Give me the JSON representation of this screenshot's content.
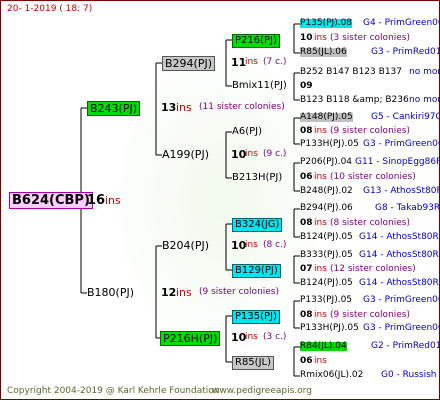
{
  "header": {
    "date": "20-  1-2019 ( 18:  7)"
  },
  "footer": {
    "copyright": "Copyright 2004-2019 @ Karl Kehrle Foundation",
    "site": "www.pedigreeapis.org"
  },
  "root": {
    "name": "B624(CBP)",
    "ins": "16",
    "ins_label": "ins"
  },
  "gen1": [
    {
      "name": "B243(PJ)",
      "ins": "13",
      "ins_label": "ins",
      "sisters": "(11 sister colonies)"
    },
    {
      "name": "B180(PJ)",
      "ins": "12",
      "ins_label": "ins",
      "sisters": "(9 sister colonies)"
    }
  ],
  "gen2": [
    {
      "name": "B294(PJ)",
      "ins": "11",
      "ins_label": "ins",
      "sisters": "(7 c.)"
    },
    {
      "name": "A199(PJ)",
      "ins": "10",
      "ins_label": "ins",
      "sisters": "(9 c.)"
    },
    {
      "name": "B204(PJ)",
      "ins": "10",
      "ins_label": "ins",
      "sisters": "(8 c.)"
    },
    {
      "name": "P216H(PJ)",
      "ins": "10",
      "ins_label": "ins",
      "sisters": "(3 c.)"
    }
  ],
  "gen3": [
    {
      "name": "P216(PJ)"
    },
    {
      "name": "Bmix11(PJ)"
    },
    {
      "name": "A6(PJ)"
    },
    {
      "name": "B213H(PJ)"
    },
    {
      "name": "B324(JG)"
    },
    {
      "name": "B129(PJ)"
    },
    {
      "name": "P135(PJ)"
    },
    {
      "name": "R85(JL)"
    }
  ],
  "gen4": [
    {
      "name": "P135(PJ).08",
      "breeder": "G4 - PrimGreen00",
      "ins": "10",
      "ins_label": "ins",
      "sisters": "(3 sister colonies)",
      "mother": "R85(JL).06",
      "mother_breeder": "G3 - PrimRed01"
    },
    {
      "name": "B252 B147 B123 B137",
      "breeder": "no more",
      "ins": "09",
      "ins_label": "",
      "sisters": "",
      "mother": "B123 B118 &amp; B236",
      "mother_breeder": "no more"
    },
    {
      "name": "A148(PJ).05",
      "breeder": "G5 - Cankiri97Q",
      "ins": "08",
      "ins_label": "ins",
      "sisters": "(9 sister colonies)",
      "mother": "P133H(PJ).05",
      "mother_breeder": "G3 - PrimGreen00"
    },
    {
      "name": "P206(PJ).04",
      "breeder": "G11 - SinopEgg86R",
      "ins": "06",
      "ins_label": "ins",
      "sisters": "(10 sister colonies)",
      "mother": "B248(PJ).02",
      "mother_breeder": "G13 - AthosSt80R"
    },
    {
      "name": "B294(PJ).06",
      "breeder": "G8 - Takab93R",
      "ins": "08",
      "ins_label": "ins",
      "sisters": "(8 sister colonies)",
      "mother": "B124(PJ).05",
      "mother_breeder": "G14 - AthosSt80R"
    },
    {
      "name": "B333(PJ).05",
      "breeder": "G14 - AthosSt80R",
      "ins": "07",
      "ins_label": "ins",
      "sisters": "(12 sister colonies)",
      "mother": "B124(PJ).05",
      "mother_breeder": "G14 - AthosSt80R"
    },
    {
      "name": "P133(PJ).05",
      "breeder": "G3 - PrimGreen00",
      "ins": "08",
      "ins_label": "ins",
      "sisters": "(9 sister colonies)",
      "mother": "P133H(PJ).05",
      "mother_breeder": "G3 - PrimGreen00"
    },
    {
      "name": "R84(JL).04",
      "breeder": "G2 - PrimRed01",
      "ins": "06",
      "ins_label": "ins",
      "sisters": "",
      "mother": "Rmix06(JL).02",
      "mother_breeder": "G0 - Russish"
    }
  ]
}
